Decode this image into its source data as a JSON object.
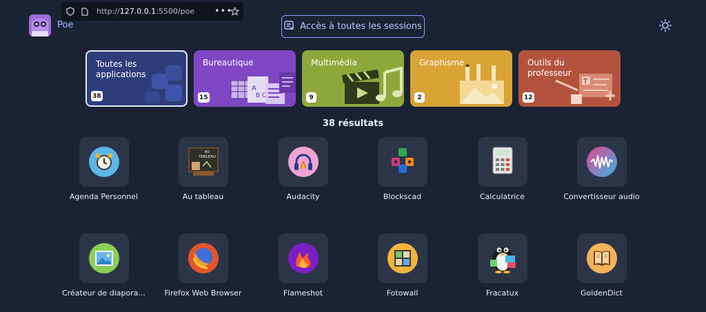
{
  "browser": {
    "url_prefix": "http://",
    "url_host": "127.0.0.1",
    "url_rest": ":5500/poe",
    "menu_dots": "•••"
  },
  "header": {
    "app_name": "Poe",
    "sessions_button": "Accès à toutes les sessions"
  },
  "categories": [
    {
      "label": "Toutes les applications",
      "count": "38",
      "color": "#2e3d7a",
      "selected": true
    },
    {
      "label": "Bureautique",
      "count": "15",
      "color": "#7f47c4"
    },
    {
      "label": "Multimédia",
      "count": "9",
      "color": "#8ea73a"
    },
    {
      "label": "Graphisme",
      "count": "2",
      "color": "#d9a335"
    },
    {
      "label": "Outils du professeur",
      "count": "12",
      "color": "#b3533e"
    }
  ],
  "results_text": "38 résultats",
  "apps": [
    {
      "name": "Agenda Personnel",
      "icon": "alarm-clock-icon"
    },
    {
      "name": "Au tableau",
      "icon": "blackboard-icon",
      "icon_text": "AU TABLEAU"
    },
    {
      "name": "Audacity",
      "icon": "headphones-icon"
    },
    {
      "name": "Blockscad",
      "icon": "blocks-icon"
    },
    {
      "name": "Calculatrice",
      "icon": "calculator-icon"
    },
    {
      "name": "Convertisseur audio",
      "icon": "waveform-icon"
    },
    {
      "name": "Créateur de diapora...",
      "icon": "picture-icon"
    },
    {
      "name": "Firefox Web Browser",
      "icon": "firefox-icon"
    },
    {
      "name": "Flameshot",
      "icon": "flame-icon"
    },
    {
      "name": "Fotowall",
      "icon": "photo-wall-icon"
    },
    {
      "name": "Fracatux",
      "icon": "penguin-icon"
    },
    {
      "name": "GoldenDict",
      "icon": "book-icon"
    }
  ]
}
